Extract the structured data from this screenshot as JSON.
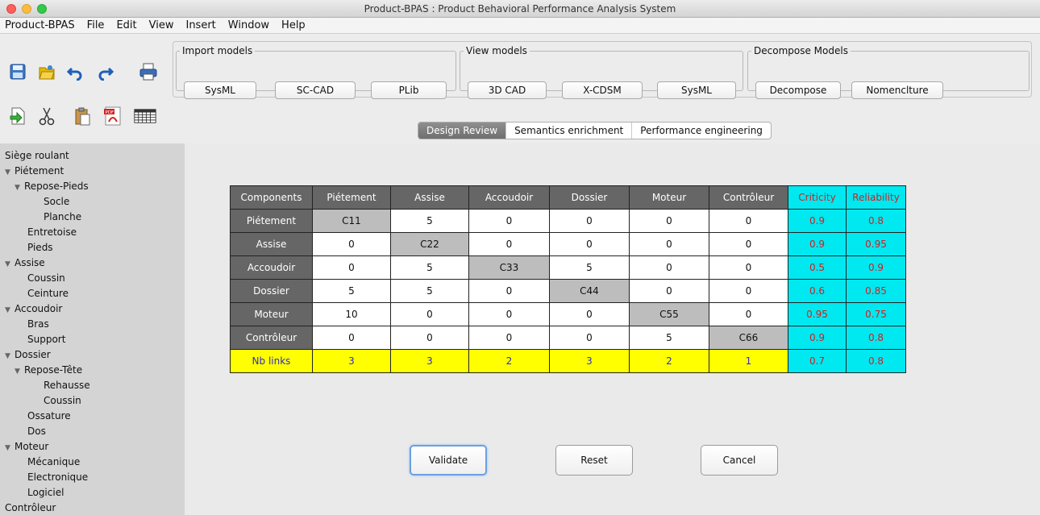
{
  "window": {
    "title": "Product-BPAS : Product Behavioral Performance Analysis System"
  },
  "menu": [
    "Product-BPAS",
    "File",
    "Edit",
    "View",
    "Insert",
    "Window",
    "Help"
  ],
  "toolbar_icons": [
    "save-icon",
    "open-icon",
    "undo-icon",
    "redo-icon",
    "print-icon",
    "import-icon",
    "cut-icon",
    "paste-icon",
    "pdf-icon",
    "table-icon"
  ],
  "groups": {
    "import": {
      "label": "Import models",
      "buttons": [
        "SysML",
        "SC-CAD",
        "PLib"
      ]
    },
    "view": {
      "label": "View models",
      "buttons": [
        "3D CAD",
        "X-CDSM",
        "SysML"
      ]
    },
    "decompose": {
      "label": "Decompose Models",
      "buttons": [
        "Decompose",
        "Nomenclture"
      ]
    }
  },
  "tabs": [
    "Design Review",
    "Semantics enrichment",
    "Performance engineering"
  ],
  "tree": [
    {
      "label": "Siège roulant",
      "level": 0,
      "expand": false
    },
    {
      "label": "Piétement",
      "level": 0,
      "expand": true
    },
    {
      "label": "Repose-Pieds",
      "level": 1,
      "expand": true
    },
    {
      "label": "Socle",
      "level": 3,
      "expand": false
    },
    {
      "label": "Planche",
      "level": 3,
      "expand": false
    },
    {
      "label": "Entretoise",
      "level": 2,
      "expand": false
    },
    {
      "label": "Pieds",
      "level": 2,
      "expand": false
    },
    {
      "label": "Assise",
      "level": 0,
      "expand": true
    },
    {
      "label": "Coussin",
      "level": 2,
      "expand": false
    },
    {
      "label": "Ceinture",
      "level": 2,
      "expand": false
    },
    {
      "label": "Accoudoir",
      "level": 0,
      "expand": true
    },
    {
      "label": "Bras",
      "level": 2,
      "expand": false
    },
    {
      "label": "Support",
      "level": 2,
      "expand": false
    },
    {
      "label": "Dossier",
      "level": 0,
      "expand": true
    },
    {
      "label": "Repose-Tête",
      "level": 1,
      "expand": true
    },
    {
      "label": "Rehausse",
      "level": 3,
      "expand": false
    },
    {
      "label": "Coussin",
      "level": 3,
      "expand": false
    },
    {
      "label": "Ossature",
      "level": 2,
      "expand": false
    },
    {
      "label": "Dos",
      "level": 2,
      "expand": false
    },
    {
      "label": "Moteur",
      "level": 0,
      "expand": true
    },
    {
      "label": "Mécanique",
      "level": 2,
      "expand": false
    },
    {
      "label": "Electronique",
      "level": 2,
      "expand": false
    },
    {
      "label": "Logiciel",
      "level": 2,
      "expand": false
    },
    {
      "label": "Contrôleur",
      "level": 0,
      "expand": false
    }
  ],
  "matrix": {
    "headers": [
      "Components",
      "Piétement",
      "Assise",
      "Accoudoir",
      "Dossier",
      "Moteur",
      "Contrôleur",
      "Criticity",
      "Reliability"
    ],
    "rows": [
      {
        "name": "Piétement",
        "cells": [
          "C11",
          "5",
          "0",
          "0",
          "0",
          "0"
        ],
        "criticity": "0.9",
        "reliability": "0.8"
      },
      {
        "name": "Assise",
        "cells": [
          "0",
          "C22",
          "0",
          "0",
          "0",
          "0"
        ],
        "criticity": "0.9",
        "reliability": "0.95"
      },
      {
        "name": "Accoudoir",
        "cells": [
          "0",
          "5",
          "C33",
          "5",
          "0",
          "0"
        ],
        "criticity": "0.5",
        "reliability": "0.9"
      },
      {
        "name": "Dossier",
        "cells": [
          "5",
          "5",
          "0",
          "C44",
          "0",
          "0"
        ],
        "criticity": "0.6",
        "reliability": "0.85"
      },
      {
        "name": "Moteur",
        "cells": [
          "10",
          "0",
          "0",
          "0",
          "C55",
          "0"
        ],
        "criticity": "0.95",
        "reliability": "0.75"
      },
      {
        "name": "Contrôleur",
        "cells": [
          "0",
          "0",
          "0",
          "0",
          "5",
          "C66"
        ],
        "criticity": "0.9",
        "reliability": "0.8"
      }
    ],
    "footer": {
      "name": "Nb links",
      "cells": [
        "3",
        "3",
        "2",
        "3",
        "2",
        "1"
      ],
      "criticity": "0.7",
      "reliability": "0.8"
    }
  },
  "actions": {
    "validate": "Validate",
    "reset": "Reset",
    "cancel": "Cancel"
  }
}
